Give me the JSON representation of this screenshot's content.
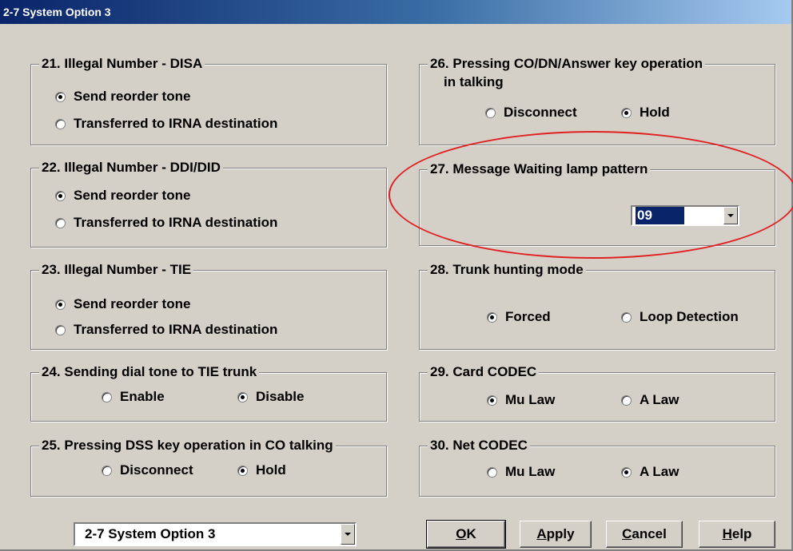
{
  "window": {
    "title": "2-7 System Option 3"
  },
  "groups": {
    "g21": {
      "title": "21. Illegal Number - DISA",
      "options": [
        {
          "label": "Send reorder tone",
          "selected": true
        },
        {
          "label": "Transferred to IRNA destination",
          "selected": false
        }
      ]
    },
    "g22": {
      "title": "22. Illegal Number - DDI/DID",
      "options": [
        {
          "label": "Send reorder tone",
          "selected": true
        },
        {
          "label": "Transferred to IRNA destination",
          "selected": false
        }
      ]
    },
    "g23": {
      "title": "23. Illegal Number - TIE",
      "options": [
        {
          "label": "Send reorder tone",
          "selected": true
        },
        {
          "label": "Transferred to IRNA destination",
          "selected": false
        }
      ]
    },
    "g24": {
      "title": "24. Sending dial tone to TIE trunk",
      "options": [
        {
          "label": "Enable",
          "selected": false
        },
        {
          "label": "Disable",
          "selected": true
        }
      ]
    },
    "g25": {
      "title": "25. Pressing DSS key operation in CO talking",
      "options": [
        {
          "label": "Disconnect",
          "selected": false
        },
        {
          "label": "Hold",
          "selected": true
        }
      ]
    },
    "g26": {
      "title": "26. Pressing CO/DN/Answer key operation",
      "title_line2": "in talking",
      "options": [
        {
          "label": "Disconnect",
          "selected": false
        },
        {
          "label": "Hold",
          "selected": true
        }
      ]
    },
    "g27": {
      "title": "27. Message Waiting lamp pattern",
      "value": "09"
    },
    "g28": {
      "title": "28. Trunk hunting mode",
      "options": [
        {
          "label": "Forced",
          "selected": true
        },
        {
          "label": "Loop Detection",
          "selected": false
        }
      ]
    },
    "g29": {
      "title": "29. Card CODEC",
      "options": [
        {
          "label": "Mu Law",
          "selected": true
        },
        {
          "label": "A Law",
          "selected": false
        }
      ]
    },
    "g30": {
      "title": "30. Net CODEC",
      "options": [
        {
          "label": "Mu Law",
          "selected": false
        },
        {
          "label": "A Law",
          "selected": true
        }
      ]
    }
  },
  "footer": {
    "page_select": "2-7 System Option 3",
    "buttons": {
      "ok_key": "O",
      "ok_rest": "K",
      "apply_key": "A",
      "apply_rest": "pply",
      "cancel_key": "C",
      "cancel_rest": "ancel",
      "help_key": "H",
      "help_rest": "elp"
    }
  },
  "colors": {
    "titlebar": "#0a246a",
    "highlight": "#e02020",
    "selection": "#0a246a"
  },
  "icons": [
    "radio-button",
    "dropdown-arrow"
  ]
}
